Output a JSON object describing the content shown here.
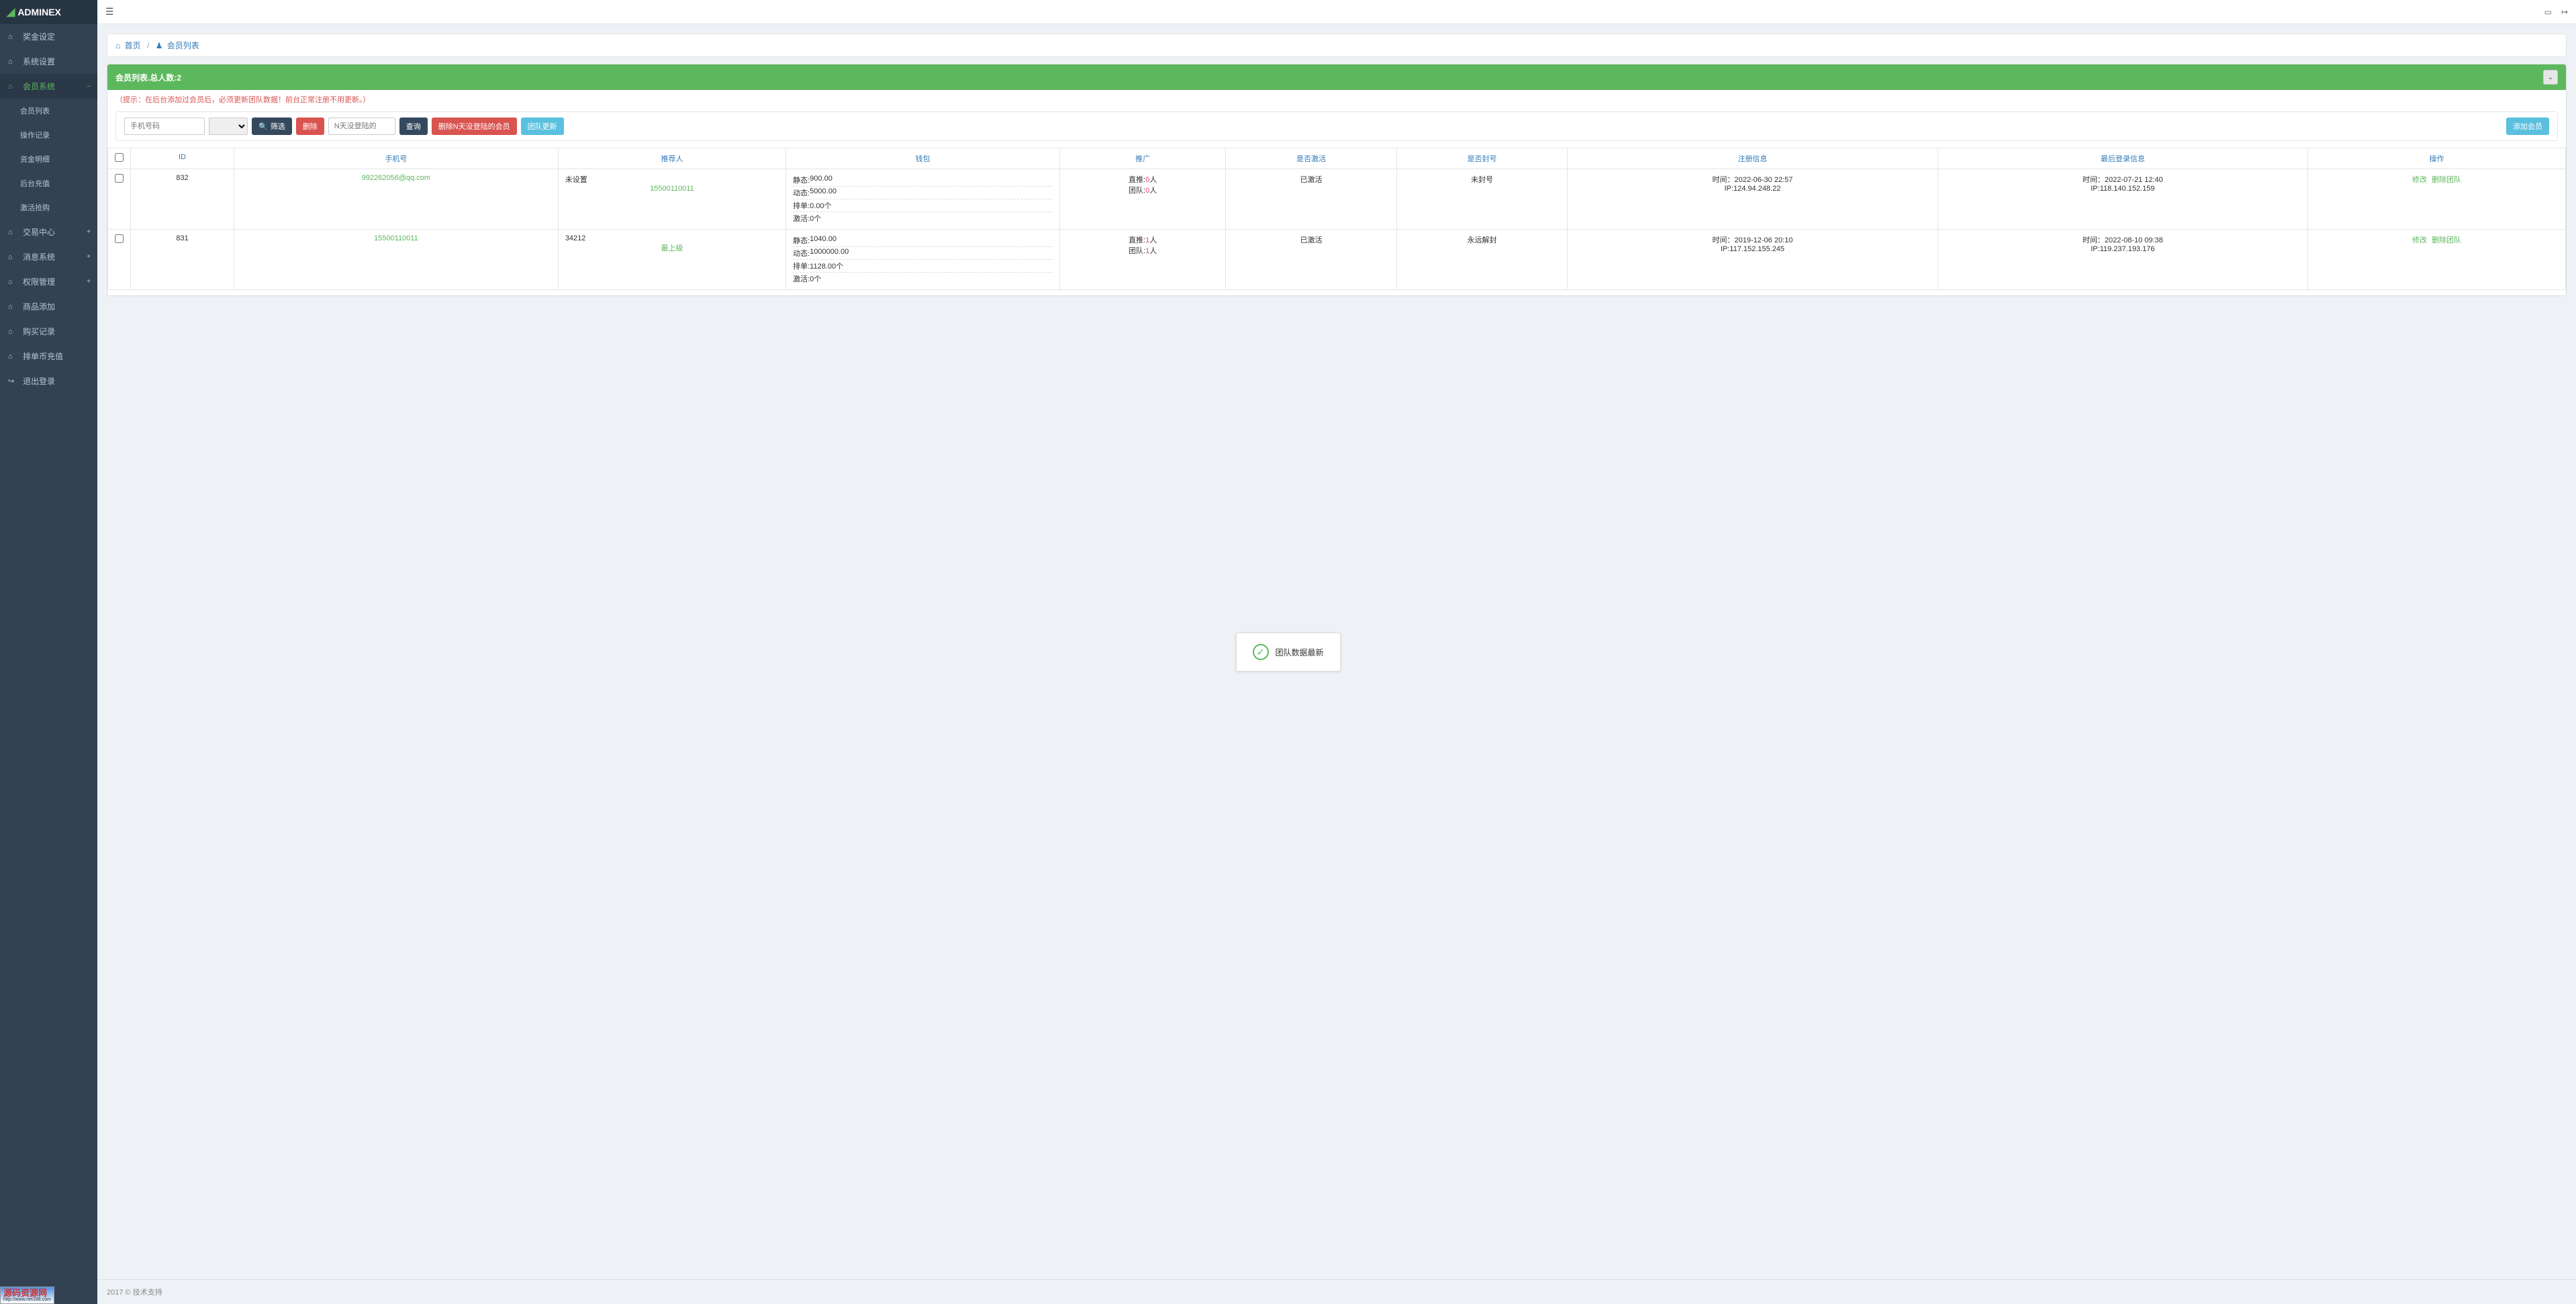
{
  "logo": {
    "text": "ADMINEX"
  },
  "sidebar": {
    "items": [
      {
        "label": "奖金设定",
        "icon": "⌂"
      },
      {
        "label": "系统设置",
        "icon": "⌂"
      },
      {
        "label": "会员系统",
        "icon": "⌂",
        "active": true,
        "expand": "–",
        "children": [
          {
            "label": "会员列表"
          },
          {
            "label": "操作记录"
          },
          {
            "label": "资金明细"
          },
          {
            "label": "后台充值"
          },
          {
            "label": "激活抢购"
          }
        ]
      },
      {
        "label": "交易中心",
        "icon": "⌂",
        "expand": "+"
      },
      {
        "label": "消息系统",
        "icon": "⌂",
        "expand": "+"
      },
      {
        "label": "权限管理",
        "icon": "⌂",
        "expand": "+"
      },
      {
        "label": "商品添加",
        "icon": "⌂"
      },
      {
        "label": "购买记录",
        "icon": "⌂"
      },
      {
        "label": "排单币充值",
        "icon": "⌂"
      },
      {
        "label": "退出登录",
        "icon": "↪"
      }
    ]
  },
  "breadcrumb": {
    "home": "首页",
    "current": "会员列表"
  },
  "panel": {
    "title": "会员列表.总人数:2"
  },
  "hint": "（提示：在后台添加过会员后，必须更新团队数据！前台正常注册不用更新。）",
  "toolbar": {
    "phone_placeholder": "手机号码",
    "filter_label": "筛选",
    "delete_label": "删除",
    "nologin_placeholder": "N天没登陆的",
    "query_label": "查询",
    "delete_n_label": "删除N天没登陆的会员",
    "team_update_label": "团队更新",
    "add_member_label": "添加会员"
  },
  "table": {
    "headers": [
      "",
      "ID",
      "手机号",
      "推荐人",
      "钱包",
      "推广",
      "是否激活",
      "是否封号",
      "注册信息",
      "最后登录信息",
      "操作"
    ],
    "rows": [
      {
        "id": "832",
        "phone": "992262056@qq.com",
        "referrer": "未设置",
        "referrer_link": true,
        "referrer_list": [
          {
            "label": "",
            "value": "15500110011",
            "link": true
          }
        ],
        "wallet": [
          {
            "label": "静态:",
            "value": "900.00"
          },
          {
            "label": "动态:",
            "value": "5000.00"
          },
          {
            "label": "排单:",
            "value": "0.00个"
          },
          {
            "label": "激活:",
            "value": "0个"
          }
        ],
        "promo": [
          {
            "label": "直推:",
            "count": "0",
            "suffix": "人"
          },
          {
            "label": "团队:",
            "count": "0",
            "suffix": "人"
          }
        ],
        "activated": "已激活",
        "banned": "未封号",
        "register": {
          "time_label": "时间：",
          "time": "2022-06-30 22:57",
          "ip_label": "IP:",
          "ip": "124.94.248.22"
        },
        "last_login": {
          "time_label": "时间：",
          "time": "2022-07-21 12:40",
          "ip_label": "IP:",
          "ip": "118.140.152.159"
        },
        "ops": [
          "修改",
          "删除团队"
        ]
      },
      {
        "id": "831",
        "phone": "15500110011",
        "referrer": "34212",
        "referrer_list": [
          {
            "label": "",
            "value": "最上级",
            "link": true
          }
        ],
        "wallet": [
          {
            "label": "静态:",
            "value": "1040.00"
          },
          {
            "label": "动态:",
            "value": "1000000.00"
          },
          {
            "label": "排单:",
            "value": "1128.00个"
          },
          {
            "label": "激活:",
            "value": "0个"
          }
        ],
        "promo": [
          {
            "label": "直推:",
            "count": "1",
            "suffix": "人"
          },
          {
            "label": "团队:",
            "count": "1",
            "suffix": "人"
          }
        ],
        "activated": "已激活",
        "banned": "永远解封",
        "register": {
          "time_label": "时间：",
          "time": "2019-12-06 20:10",
          "ip_label": "IP:",
          "ip": "117.152.155.245"
        },
        "last_login": {
          "time_label": "时间：",
          "time": "2022-08-10 09:38",
          "ip_label": "IP:",
          "ip": "119.237.193.176"
        },
        "ops": [
          "修改",
          "删除团队"
        ]
      }
    ]
  },
  "notify": {
    "text": "团队数据最新"
  },
  "footer": "2017 © 技术支持",
  "watermark": {
    "line1": "源码资源网",
    "line2": "http://www.net188.com"
  }
}
